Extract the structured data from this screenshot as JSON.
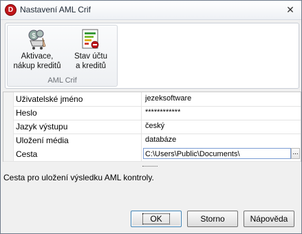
{
  "window": {
    "title": "Nastavení AML Crif",
    "app_icon_letter": "D",
    "close_glyph": "✕"
  },
  "ribbon": {
    "group_caption": "AML Crif",
    "buttons": [
      {
        "label_line1": "Aktivace,",
        "label_line2": "nákup kreditů",
        "icon": "money-cart-icon"
      },
      {
        "label_line1": "Stav účtu",
        "label_line2": "a kreditů",
        "icon": "account-status-icon"
      }
    ]
  },
  "properties": [
    {
      "name": "Uživatelské jméno",
      "value": "jezeksoftware"
    },
    {
      "name": "Heslo",
      "value": "************"
    },
    {
      "name": "Jazyk výstupu",
      "value": "český"
    },
    {
      "name": "Uložení média",
      "value": "databáze"
    },
    {
      "name": "Cesta",
      "value": "C:\\Users\\Public\\Documents\\"
    }
  ],
  "ellipsis": "...",
  "help_text": "Cesta pro uložení výsledku AML kontroly.",
  "buttons": {
    "ok": "OK",
    "cancel": "Storno",
    "help": "Nápověda"
  },
  "colors": {
    "accent_red": "#c0151a",
    "selection_border": "#7a9cd3"
  }
}
